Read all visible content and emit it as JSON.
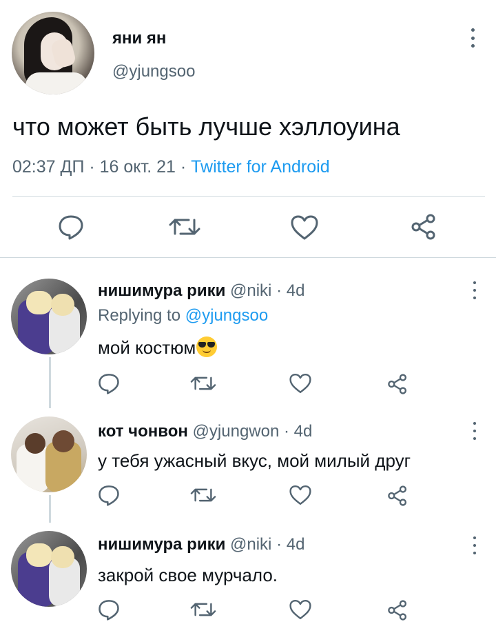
{
  "main_tweet": {
    "display_name": "яни ян",
    "handle": "@yjungsoo",
    "text": "что может быть лучше хэллоуина",
    "time": "02:37 ДП",
    "date": "16 окт. 21",
    "separator": " · ",
    "source": "Twitter for Android",
    "actions": [
      "reply-icon",
      "retweet-icon",
      "like-icon",
      "share-icon"
    ]
  },
  "replies": [
    {
      "display_name": "нишимура рики",
      "handle": "@niki",
      "time": "· 4d",
      "replying_prefix": "Replying to",
      "replying_to": "@yjungsoo",
      "text": "мой костюм",
      "emoji": "smiling-face-with-sunglasses"
    },
    {
      "display_name": "кот чонвон",
      "handle": "@yjungwon",
      "time": "· 4d",
      "text": "у тебя ужасный вкус, мой милый друг"
    },
    {
      "display_name": "нишимура рики",
      "handle": "@niki",
      "time": "· 4d",
      "text": "закрой свое мурчало."
    }
  ],
  "colors": {
    "text": "#0f1419",
    "secondary": "#536471",
    "link": "#1d9bf0",
    "divider": "#cfd9de"
  }
}
